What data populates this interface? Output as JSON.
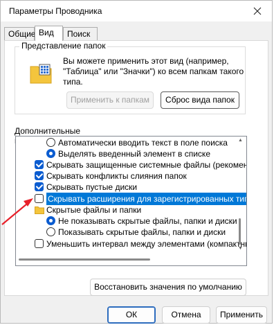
{
  "window": {
    "title": "Параметры Проводника"
  },
  "tabs": [
    {
      "label": "Общие",
      "active": false
    },
    {
      "label": "Вид",
      "active": true
    },
    {
      "label": "Поиск",
      "active": false
    }
  ],
  "folder_views": {
    "title": "Представление папок",
    "description": "Вы можете применить этот вид (например, \"Таблица\" или \"Значки\") ко всем папкам такого типа.",
    "apply_button": "Применить к папкам",
    "reset_button": "Сброс вида папок"
  },
  "advanced": {
    "label": "Дополнительные параметры:",
    "items": [
      {
        "kind": "radio",
        "checked": false,
        "text": "Автоматически вводить текст в поле поиска"
      },
      {
        "kind": "radio",
        "checked": true,
        "text": "Выделять введенный элемент в списке"
      },
      {
        "kind": "checkbox",
        "checked": true,
        "text": "Скрывать защищенные системные файлы (рекомен,"
      },
      {
        "kind": "checkbox",
        "checked": true,
        "text": "Скрывать конфликты слияния папок"
      },
      {
        "kind": "checkbox",
        "checked": true,
        "text": "Скрывать пустые диски"
      },
      {
        "kind": "checkbox",
        "checked": false,
        "selected": true,
        "text": "Скрывать расширения для зарегистрированных типо"
      },
      {
        "kind": "folder",
        "text": "Скрытые файлы и папки"
      },
      {
        "kind": "radio",
        "checked": true,
        "text": "Не показывать скрытые файлы, папки и диски"
      },
      {
        "kind": "radio",
        "checked": false,
        "text": "Показывать скрытые файлы, папки и диски"
      },
      {
        "kind": "checkbox",
        "checked": false,
        "text": "Уменьшить интервал между элементами (компактны"
      }
    ]
  },
  "restore_button": "Восстановить значения по умолчанию",
  "footer": {
    "ok": "ОК",
    "cancel": "Отмена",
    "apply": "Применить"
  },
  "colors": {
    "accent": "#0078d7",
    "check": "#0b5cd0",
    "annotation_arrow": "#e8202a"
  },
  "icons": [
    "close-icon",
    "folder-view-icon",
    "folder-icon",
    "annotation-arrow"
  ]
}
